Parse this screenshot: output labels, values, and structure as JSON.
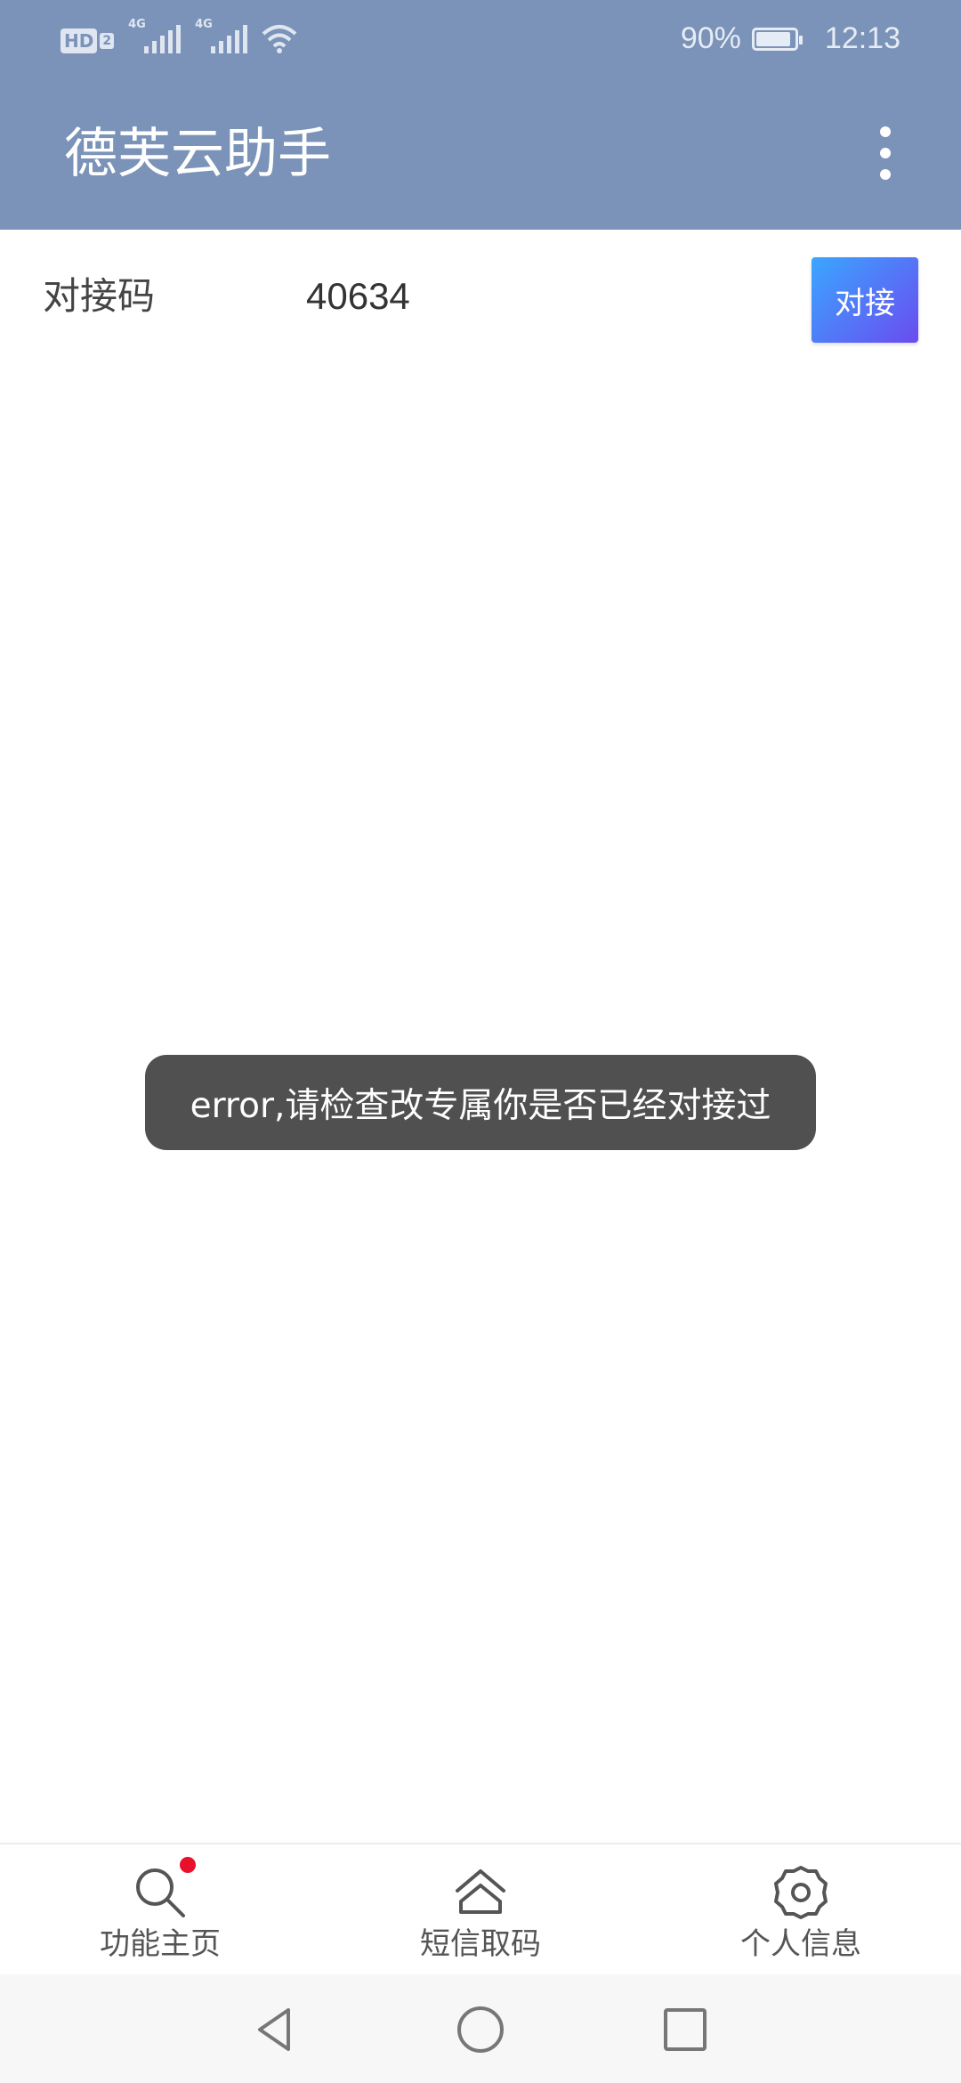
{
  "status_bar": {
    "hd_label": "HD",
    "sim_number": "2",
    "network_type_1": "4G",
    "network_type_2": "4G",
    "battery_percent": "90%",
    "time": "12:13",
    "icons": [
      "hd-icon",
      "signal-icon",
      "signal-icon",
      "wifi-icon",
      "battery-charging-icon"
    ]
  },
  "app_bar": {
    "title": "德芙云助手",
    "menu_icon": "more-vertical-icon"
  },
  "connect_row": {
    "label": "对接码",
    "code": "40634",
    "button_label": "对接"
  },
  "toast": {
    "message": "error,请检查改专属你是否已经对接过"
  },
  "bottom_nav": {
    "items": [
      {
        "label": "功能主页",
        "icon": "search-icon",
        "has_badge": true
      },
      {
        "label": "短信取码",
        "icon": "home-icon",
        "has_badge": false
      },
      {
        "label": "个人信息",
        "icon": "gear-icon",
        "has_badge": false
      }
    ]
  },
  "system_nav": {
    "icons": [
      "back-icon",
      "home-circle-icon",
      "recents-icon"
    ]
  },
  "colors": {
    "app_bar": "#7b93b8",
    "button_gradient_start": "#3aa6ff",
    "button_gradient_end": "#6a4cf0",
    "toast_bg": "#505050",
    "badge": "#e8102a"
  }
}
